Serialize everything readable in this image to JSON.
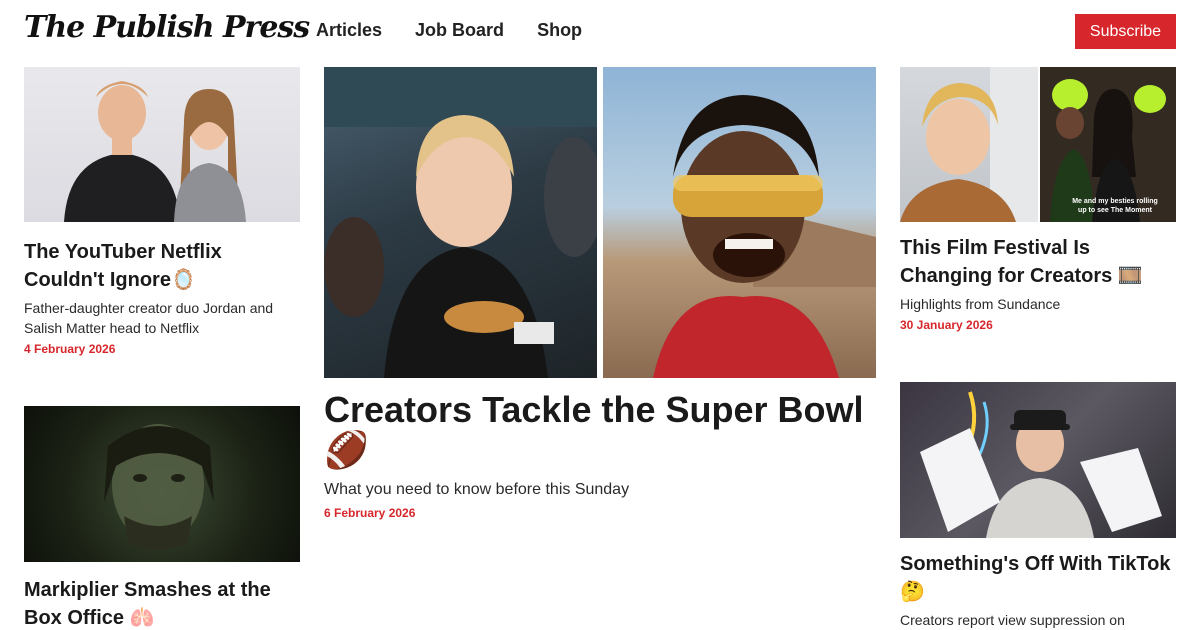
{
  "header": {
    "logo": "The Publish Press",
    "nav": [
      "Articles",
      "Job Board",
      "Shop"
    ],
    "subscribe": "Subscribe"
  },
  "articles": {
    "youtuber": {
      "title": "The YouTuber Netflix Couldn't Ignore🪞",
      "subtitle": "Father-daughter creator duo Jordan and Salish Matter head to Netflix",
      "date": "4 February 2026"
    },
    "markiplier": {
      "title": "Markiplier Smashes at the Box Office 🫁"
    },
    "superbowl": {
      "title": "Creators Tackle the Super Bowl 🏈",
      "subtitle": "What you need to know before this Sunday",
      "date": "6 February 2026"
    },
    "festival": {
      "title": "This Film Festival Is Changing for Creators 🎞️",
      "subtitle": "Highlights from Sundance",
      "date": "30 January 2026",
      "image_caption": "Me and my besties rolling up to see The Moment"
    },
    "tiktok": {
      "title": "Something's Off With TikTok 🤔",
      "subtitle": "Creators report view suppression on"
    }
  },
  "colors": {
    "accent": "#d7262c",
    "text": "#1a1a1a",
    "background": "#ffffff"
  }
}
